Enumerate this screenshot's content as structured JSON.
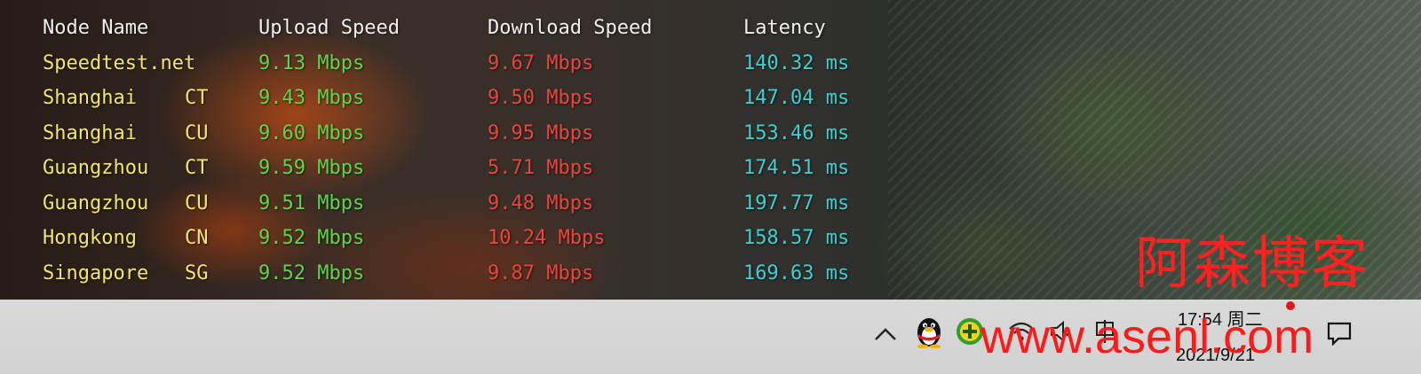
{
  "terminal": {
    "headers": {
      "node": "Node Name",
      "upload": "Upload Speed",
      "download": "Download Speed",
      "latency": "Latency"
    },
    "rows": [
      {
        "name": "Speedtest.net",
        "code": "",
        "upload": "9.13 Mbps",
        "download": "9.67 Mbps",
        "latency": "140.32 ms"
      },
      {
        "name": "Shanghai",
        "code": "CT",
        "upload": "9.43 Mbps",
        "download": "9.50 Mbps",
        "latency": "147.04 ms"
      },
      {
        "name": "Shanghai",
        "code": "CU",
        "upload": "9.60 Mbps",
        "download": "9.95 Mbps",
        "latency": "153.46 ms"
      },
      {
        "name": "Guangzhou",
        "code": "CT",
        "upload": "9.59 Mbps",
        "download": "5.71 Mbps",
        "latency": "174.51 ms"
      },
      {
        "name": "Guangzhou",
        "code": "CU",
        "upload": "9.51 Mbps",
        "download": "9.48 Mbps",
        "latency": "197.77 ms"
      },
      {
        "name": "Hongkong",
        "code": "CN",
        "upload": "9.52 Mbps",
        "download": "10.24 Mbps",
        "latency": "158.57 ms"
      },
      {
        "name": "Singapore",
        "code": "SG",
        "upload": "9.52 Mbps",
        "download": "9.87 Mbps",
        "latency": "169.63 ms"
      }
    ]
  },
  "watermark": {
    "cn": "阿森博客",
    "url": "www.asenl.com"
  },
  "taskbar": {
    "clock_time": "17:54 周二",
    "clock_date": "2021/9/21",
    "tray_icons": [
      "chevron-up-icon",
      "qq-penguin-icon",
      "download-plus-icon",
      "wifi-icon",
      "volume-icon",
      "ime-icon"
    ],
    "notification": "notification-icon"
  },
  "colors": {
    "header": "#f0f0f0",
    "node": "#f2e56b",
    "upload": "#5ed44a",
    "download": "#e8453c",
    "latency": "#3fcfd2",
    "watermark": "#ff1a1a"
  }
}
